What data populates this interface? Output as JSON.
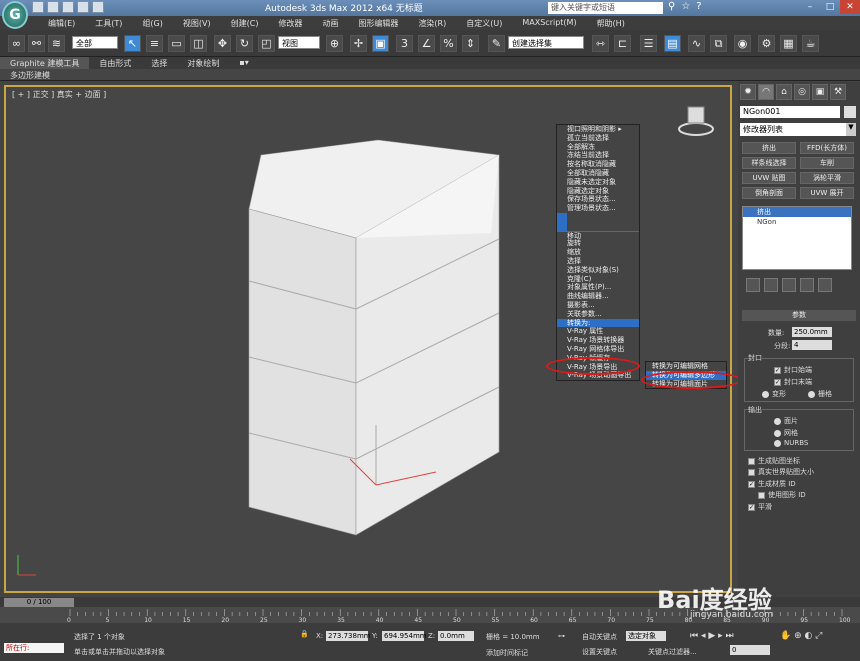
{
  "window": {
    "title": "Autodesk 3ds Max  2012 x64      无标题",
    "search_placeholder": "键入关键字或短语",
    "logo": "G"
  },
  "menu": [
    "编辑(E)",
    "工具(T)",
    "组(G)",
    "视图(V)",
    "创建(C)",
    "修改器",
    "动画",
    "图形编辑器",
    "渲染(R)",
    "自定义(U)",
    "MAXScript(M)",
    "帮助(H)"
  ],
  "toolbar": {
    "selection_filter": "全部",
    "view_mode": "视图",
    "named_selection": "创建选择集"
  },
  "ribbon": {
    "tabs": [
      "Graphite 建模工具",
      "自由形式",
      "选择",
      "对象绘制"
    ],
    "subtitle": "多边形建模"
  },
  "viewport": {
    "label": "[ + ] 正交 ] 真实 + 边面 ]"
  },
  "context_menu": {
    "items": [
      "视口照明和阴影 ▸",
      "孤立当前选择",
      "全部解冻",
      "冻结当前选择",
      "按名称取消隐藏",
      "全部取消隐藏",
      "隐藏未选定对象",
      "隐藏选定对象",
      "保存场景状态...",
      "管理场景状态...",
      "",
      "",
      "移动",
      "旋转",
      "缩放",
      "选择",
      "选择类似对象(S)",
      "克隆(C)",
      "对象属性(P)...",
      "曲线编辑器...",
      "摄影表...",
      "关联参数...",
      "转换为:",
      "V-Ray 属性",
      "V-Ray 场景转换器",
      "V-Ray 网格体导出",
      "V-Ray 帧缓存",
      "V-Ray 场景导出",
      "V-Ray 场景动画导出"
    ],
    "highlighted_index": 22,
    "submenu": [
      "转换为可编辑网格",
      "转换为可编辑多边形",
      "转换为可编辑面片"
    ]
  },
  "command_panel": {
    "object_name": "NGon001",
    "modifier_list": "修改器列表",
    "mod_buttons": [
      "挤出",
      "FFD(长方体)",
      "样条线选择",
      "车削",
      "UVW 贴图",
      "涡轮平滑",
      "倒角剖面",
      "UVW 展开"
    ],
    "stack": [
      "挤出",
      "NGon"
    ],
    "params": {
      "title": "参数",
      "amount_label": "数量:",
      "amount": "250.0mm",
      "segments_label": "分段:",
      "segments": "4",
      "cap_label": "封口",
      "cap_start": "封口始端",
      "cap_end": "封口末端",
      "morph": "变形",
      "grid": "栅格",
      "output_label": "输出",
      "out_patch": "面片",
      "out_mesh": "网格",
      "out_nurbs": "NURBS",
      "gen_mapping": "生成贴图坐标",
      "real_world": "真实世界贴图大小",
      "gen_mat_ids": "生成材质 ID",
      "use_shape_ids": "使用图形 ID",
      "smooth": "平滑"
    }
  },
  "timeline": {
    "frame": "0 / 100",
    "ticks": [
      "0",
      "5",
      "10",
      "15",
      "20",
      "25",
      "30",
      "35",
      "40",
      "45",
      "50",
      "55",
      "60",
      "65",
      "70",
      "75",
      "80",
      "85",
      "90",
      "95",
      "100"
    ]
  },
  "status": {
    "mode": "所在行:",
    "selected": "选择了 1 个对象",
    "prompt": "单击或单击并拖动以选择对象",
    "x_label": "X:",
    "x": "273.738mm",
    "y_label": "Y:",
    "y": "694.954mm",
    "z_label": "Z:",
    "z": "0.0mm",
    "grid": "栅格 = 10.0mm",
    "auto_key": "自动关键点",
    "sel_set": "选定对象",
    "set_key": "设置关键点",
    "key_filters": "关键点过滤器...",
    "add_time_tag": "添加时间标记"
  },
  "watermark": {
    "text": "Bai度经验",
    "sub": "jingyan.baidu.com"
  }
}
